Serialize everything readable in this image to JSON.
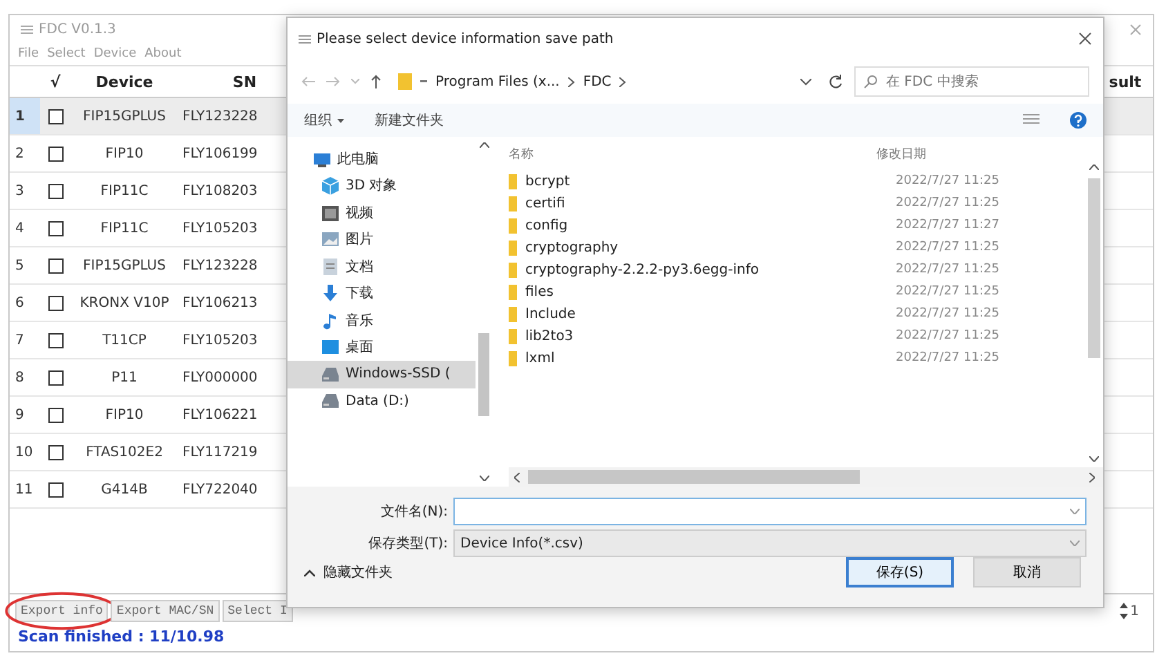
{
  "main_window": {
    "title": "FDC V0.1.3",
    "menu": [
      "File",
      "Select",
      "Device",
      "About"
    ]
  },
  "table": {
    "columns": [
      "√",
      "Device",
      "SN",
      "sult"
    ],
    "rows": [
      {
        "index": "1",
        "checked": false,
        "selected": true,
        "device": "FIP15GPLUS",
        "sn": "FLY123228"
      },
      {
        "index": "2",
        "checked": false,
        "selected": false,
        "device": "FIP10",
        "sn": "FLY106199"
      },
      {
        "index": "3",
        "checked": false,
        "selected": false,
        "device": "FIP11C",
        "sn": "FLY108203"
      },
      {
        "index": "4",
        "checked": false,
        "selected": false,
        "device": "FIP11C",
        "sn": "FLY105203"
      },
      {
        "index": "5",
        "checked": false,
        "selected": false,
        "device": "FIP15GPLUS",
        "sn": "FLY123228"
      },
      {
        "index": "6",
        "checked": false,
        "selected": false,
        "device": "KRONX V10P",
        "sn": "FLY106213"
      },
      {
        "index": "7",
        "checked": false,
        "selected": false,
        "device": "T11CP",
        "sn": "FLY105203"
      },
      {
        "index": "8",
        "checked": false,
        "selected": false,
        "device": "P11",
        "sn": "FLY000000"
      },
      {
        "index": "9",
        "checked": false,
        "selected": false,
        "device": "FIP10",
        "sn": "FLY106221"
      },
      {
        "index": "10",
        "checked": false,
        "selected": false,
        "device": "FTAS102E2",
        "sn": "FLY117219"
      },
      {
        "index": "11",
        "checked": false,
        "selected": false,
        "device": "G414B",
        "sn": "FLY722040"
      }
    ]
  },
  "buttons": [
    {
      "label": "Export info",
      "circled": true
    },
    {
      "label": "Export MAC/SN",
      "circled": false
    },
    {
      "label": "Select I",
      "circled": false
    }
  ],
  "page_number": "1",
  "status": "Scan finished : 11/10.98",
  "dialog": {
    "title": "Please select device information save path",
    "path": [
      "Program Files (x...",
      "FDC"
    ],
    "search": {
      "placeholder": "在 FDC 中搜索"
    },
    "toolbar": {
      "organize": "组织",
      "new_folder": "新建文件夹"
    },
    "nav": [
      {
        "label": "此电脑",
        "kind": "pc",
        "selected": false,
        "children": [
          {
            "label": "3D 对象",
            "kind": "cube",
            "selected": false
          },
          {
            "label": "视频",
            "kind": "video",
            "selected": false
          },
          {
            "label": "图片",
            "kind": "picture",
            "selected": false
          },
          {
            "label": "文档",
            "kind": "document",
            "selected": false
          },
          {
            "label": "下载",
            "kind": "download",
            "selected": false
          },
          {
            "label": "音乐",
            "kind": "music",
            "selected": false
          },
          {
            "label": "桌面",
            "kind": "desktop",
            "selected": false
          },
          {
            "label": "Windows-SSD (",
            "kind": "drive",
            "selected": true
          },
          {
            "label": "Data (D:)",
            "kind": "drive",
            "selected": false
          }
        ]
      }
    ],
    "files": {
      "columns": [
        "名称",
        "修改日期"
      ],
      "rows": [
        {
          "name": "bcrypt",
          "modified": "2022/7/27 11:25"
        },
        {
          "name": "certifi",
          "modified": "2022/7/27 11:25"
        },
        {
          "name": "config",
          "modified": "2022/7/27 11:27"
        },
        {
          "name": "cryptography",
          "modified": "2022/7/27 11:25"
        },
        {
          "name": "cryptography-2.2.2-py3.6egg-info",
          "modified": "2022/7/27 11:25"
        },
        {
          "name": "files",
          "modified": "2022/7/27 11:25"
        },
        {
          "name": "Include",
          "modified": "2022/7/27 11:25"
        },
        {
          "name": "lib2to3",
          "modified": "2022/7/27 11:25"
        },
        {
          "name": "lxml",
          "modified": "2022/7/27 11:25"
        }
      ]
    },
    "file_name": {
      "label": "文件名(N):"
    },
    "file_type": {
      "label": "保存类型(T):",
      "value": "Device Info(*.csv)"
    },
    "hide_folders": "隐藏文件夹",
    "actions": [
      {
        "label": "保存(S)",
        "default": true
      },
      {
        "label": "取消",
        "default": false
      }
    ]
  }
}
